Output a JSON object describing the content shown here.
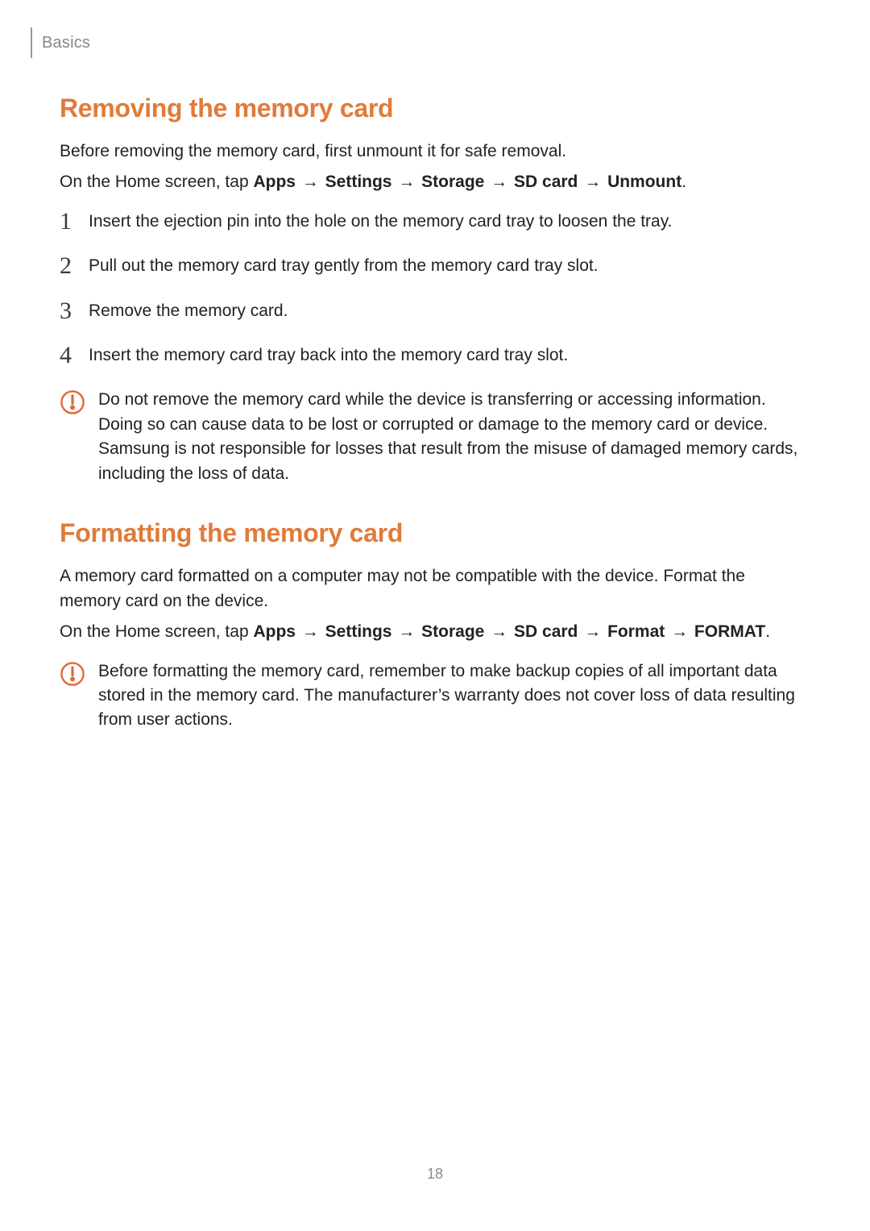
{
  "header": {
    "section_label": "Basics"
  },
  "page_number": "18",
  "removing": {
    "title": "Removing the memory card",
    "intro": "Before removing the memory card, first unmount it for safe removal.",
    "path_prefix": "On the Home screen, tap ",
    "path_items": [
      "Apps",
      "Settings",
      "Storage",
      "SD card",
      "Unmount"
    ],
    "path_arrow": "→",
    "steps": [
      "Insert the ejection pin into the hole on the memory card tray to loosen the tray.",
      "Pull out the memory card tray gently from the memory card tray slot.",
      "Remove the memory card.",
      "Insert the memory card tray back into the memory card tray slot."
    ],
    "caution": "Do not remove the memory card while the device is transferring or accessing information. Doing so can cause data to be lost or corrupted or damage to the memory card or device. Samsung is not responsible for losses that result from the misuse of damaged memory cards, including the loss of data."
  },
  "formatting": {
    "title": "Formatting the memory card",
    "intro": "A memory card formatted on a computer may not be compatible with the device. Format the memory card on the device.",
    "path_prefix": "On the Home screen, tap ",
    "path_items": [
      "Apps",
      "Settings",
      "Storage",
      "SD card",
      "Format",
      "FORMAT"
    ],
    "path_arrow": "→",
    "caution": "Before formatting the memory card, remember to make backup copies of all important data stored in the memory card. The manufacturer’s warranty does not cover loss of data resulting from user actions."
  }
}
